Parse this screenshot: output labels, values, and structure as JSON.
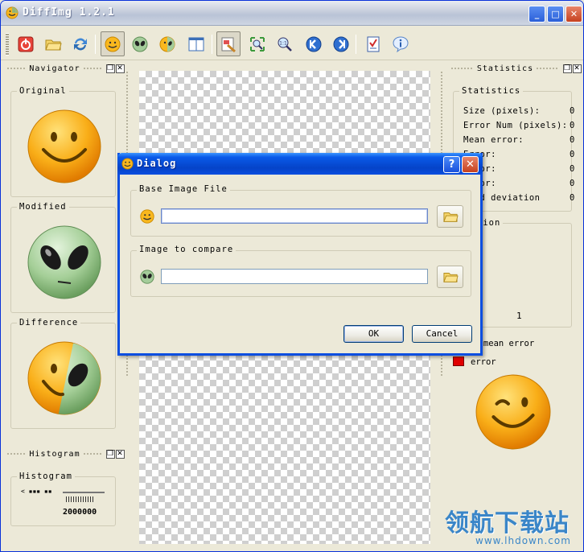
{
  "window": {
    "title": "DiffImg 1.2.1"
  },
  "colors": {
    "accent": "#0a4ee0",
    "error": "#e00000",
    "watermark": "#3a86c8"
  },
  "toolbar": {
    "icons": [
      "exit-icon",
      "open-folder-icon",
      "refresh-icon",
      "original-smiley-icon",
      "modified-alien-icon",
      "difference-icon",
      "split-view-icon",
      "mask-tool-icon",
      "fit-zoom-icon",
      "zoom-1to1-icon",
      "previous-icon",
      "next-icon",
      "checklist-icon",
      "info-icon"
    ]
  },
  "navigator": {
    "title": "Navigator",
    "groups": {
      "original": "Original",
      "modified": "Modified",
      "difference": "Difference"
    }
  },
  "histogram": {
    "title": "Histogram",
    "group_label": "Histogram",
    "axis_top": "< ▪▪▪ ▪▪",
    "axis_bottom": "2000000"
  },
  "statistics": {
    "title": "Statistics",
    "group_label": "Statistics",
    "rows": [
      {
        "label": "Size (pixels):",
        "value": "0"
      },
      {
        "label": "Error Num (pixels):",
        "value": "0"
      },
      {
        "label": "Mean error:",
        "value": "0"
      },
      {
        "label": "Error:",
        "value": "0"
      },
      {
        "label": "error:",
        "value": "0"
      },
      {
        "label": "error:",
        "value": "0"
      },
      {
        "label": "dard deviation",
        "value": "0"
      }
    ],
    "section2_label": "tion",
    "section2_value": "1",
    "legend_1": "ror > mean error",
    "legend_2": "error"
  },
  "dialog": {
    "title": "Dialog",
    "help_label": "?",
    "close_label": "✕",
    "base_group": "Base Image File",
    "base_value": "",
    "compare_group": "Image to compare",
    "compare_value": "",
    "ok_label": "OK",
    "cancel_label": "Cancel"
  },
  "watermark": {
    "text": "领航下载站",
    "url": "www.lhdown.com"
  }
}
